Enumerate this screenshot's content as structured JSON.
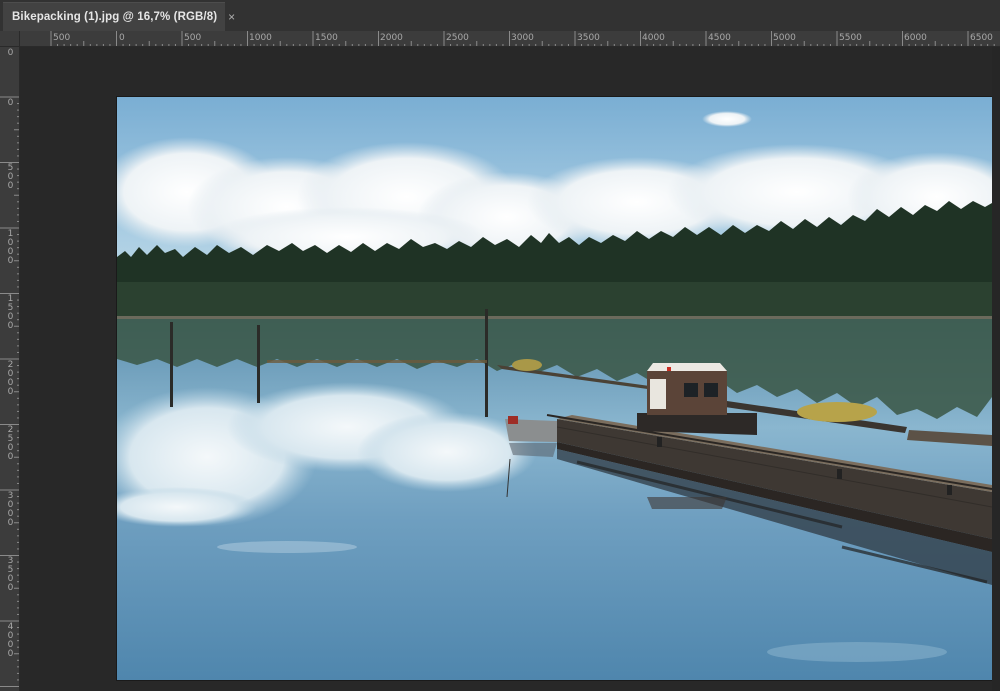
{
  "document_tab": {
    "title": "Bikepacking (1).jpg @ 16,7% (RGB/8)",
    "close_icon": "×"
  },
  "ruler_horizontal": {
    "labels": [
      "500",
      "0",
      "500",
      "1000",
      "1500",
      "2000",
      "2500",
      "3000",
      "3500",
      "4000",
      "4500",
      "5000",
      "5500",
      "6000",
      "6500"
    ]
  },
  "ruler_vertical": {
    "labels": [
      "0",
      "0",
      "500",
      "1000",
      "1500",
      "2000",
      "2500",
      "3000",
      "3500",
      "4000"
    ]
  },
  "canvas": {
    "background": "#282828",
    "image_description_icon": "photo-lake-dock-boat"
  },
  "colors": {
    "ui_dark": "#282828",
    "tab_active": "#424242",
    "ruler": "#3c3c3c"
  }
}
